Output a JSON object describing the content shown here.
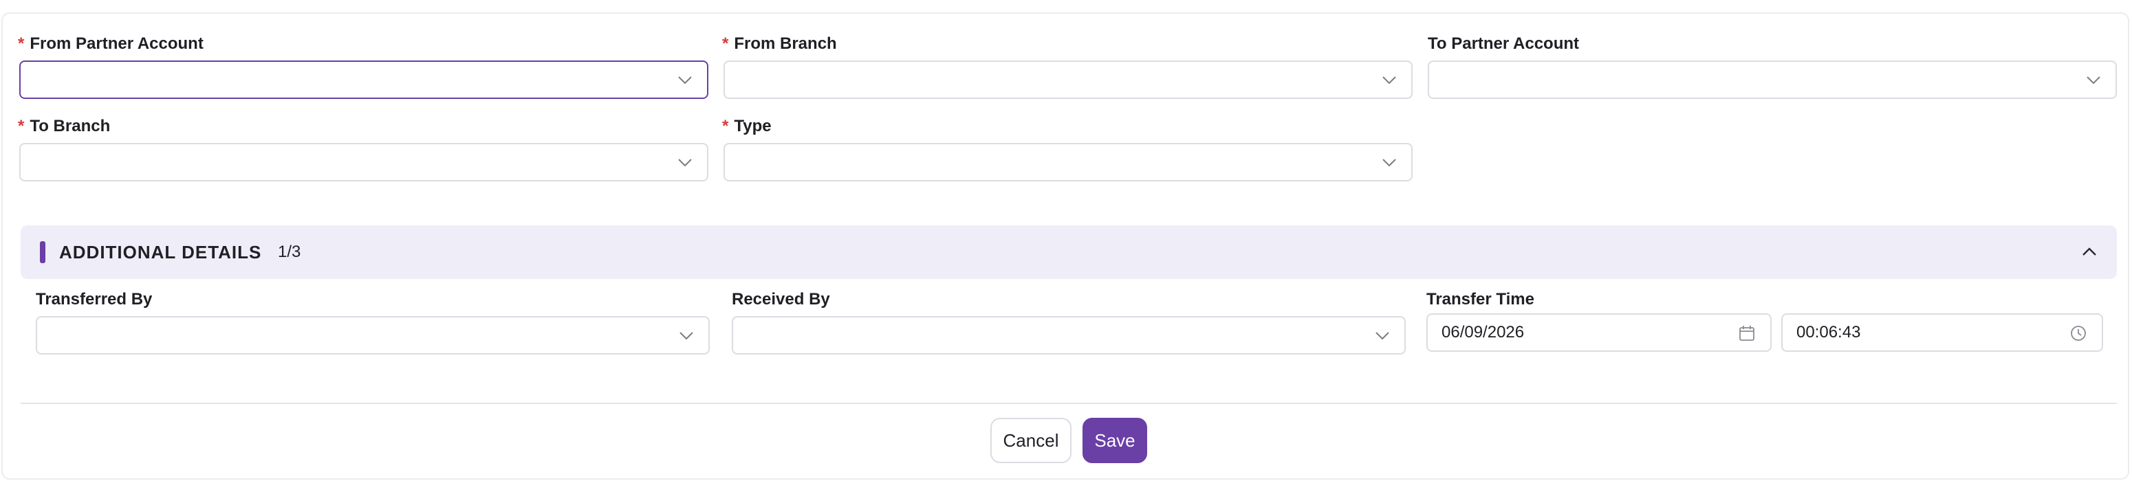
{
  "form": {
    "fields": {
      "from_partner_account": {
        "label": "From Partner Account",
        "required": "*",
        "value": ""
      },
      "from_branch": {
        "label": "From Branch",
        "required": "*",
        "value": ""
      },
      "to_partner_account": {
        "label": "To Partner Account",
        "value": ""
      },
      "to_branch": {
        "label": "To Branch",
        "required": "*",
        "value": ""
      },
      "type": {
        "label": "Type",
        "required": "*",
        "value": ""
      }
    }
  },
  "additional_details": {
    "title": "ADDITIONAL DETAILS",
    "count": "1/3",
    "fields": {
      "transferred_by": {
        "label": "Transferred By",
        "value": ""
      },
      "received_by": {
        "label": "Received By",
        "value": ""
      },
      "transfer_time": {
        "label": "Transfer Time",
        "date": "06/09/2026",
        "time": "00:06:43"
      }
    }
  },
  "actions": {
    "cancel_label": "Cancel",
    "save_label": "Save"
  },
  "icons": {
    "dropdown": "chevron-down-icon",
    "collapse": "chevron-up-icon",
    "date": "calendar-icon",
    "time": "clock-icon"
  },
  "colors": {
    "accent": "#6a3fa6",
    "required": "#d63b3b",
    "section_bg": "#efedf7"
  }
}
